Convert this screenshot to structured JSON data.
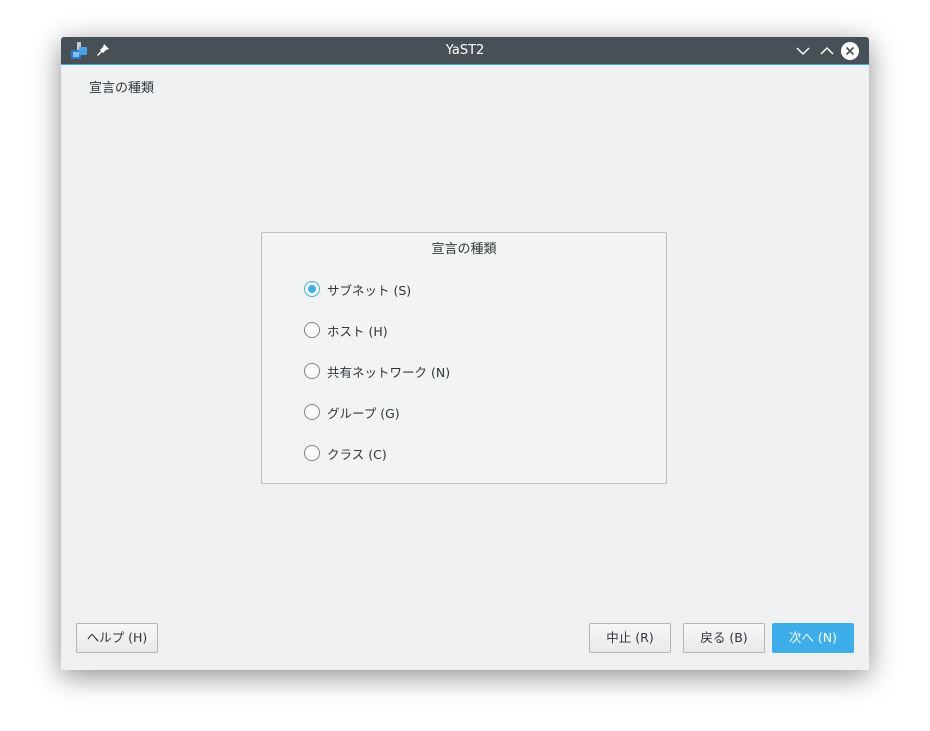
{
  "window": {
    "title": "YaST2"
  },
  "page": {
    "title": "宣言の種類"
  },
  "group": {
    "title": "宣言の種類",
    "options": [
      {
        "label": "サブネット (S)",
        "checked": true
      },
      {
        "label": "ホスト (H)",
        "checked": false
      },
      {
        "label": "共有ネットワーク (N)",
        "checked": false
      },
      {
        "label": "グループ (G)",
        "checked": false
      },
      {
        "label": "クラス (C)",
        "checked": false
      }
    ]
  },
  "buttons": {
    "help": "ヘルプ (H)",
    "abort": "中止 (R)",
    "back": "戻る (B)",
    "next": "次へ (N)"
  },
  "colors": {
    "accent": "#3daee9",
    "titlebar": "#475057",
    "window_bg": "#eff0f1"
  },
  "icons": {
    "app": "yast-icon",
    "pin": "pin-icon",
    "minimize": "chevron-down-icon",
    "maximize": "chevron-up-icon",
    "close": "close-icon"
  }
}
